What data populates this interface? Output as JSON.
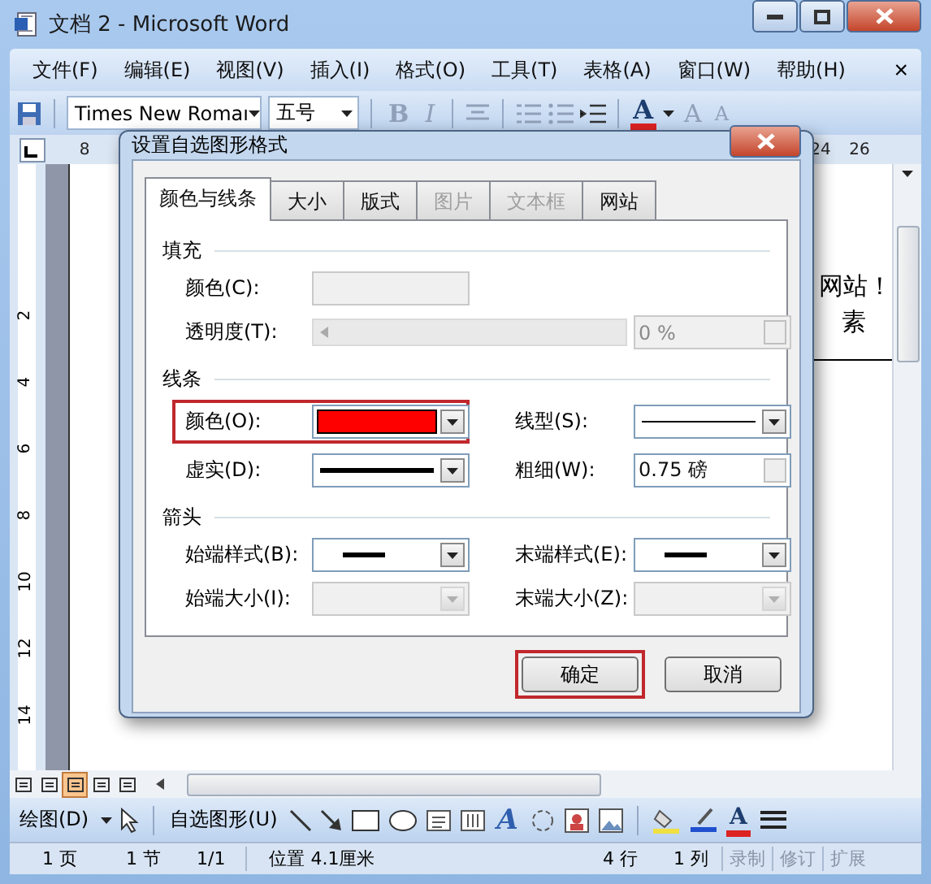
{
  "window": {
    "title": "文档 2 - Microsoft Word"
  },
  "menu": {
    "items": [
      "文件(F)",
      "编辑(E)",
      "视图(V)",
      "插入(I)",
      "格式(O)",
      "工具(T)",
      "表格(A)",
      "窗口(W)",
      "帮助(H)"
    ],
    "close": "×"
  },
  "toolbar": {
    "font": "Times New Romaı",
    "size": "五号",
    "format_buttons": [
      {
        "label": "B",
        "disabled": true
      },
      {
        "label": "I",
        "disabled": true
      }
    ],
    "font_color": "A",
    "grow": "A",
    "shrink": "A"
  },
  "ruler": {
    "labels": [
      "8",
      "24",
      "26"
    ],
    "vertical_labels": [
      "2",
      "4",
      "6",
      "8",
      "10",
      "12",
      "14"
    ]
  },
  "document": {
    "lines": [
      "网站！",
      "素"
    ]
  },
  "dialog": {
    "title": "设置自选图形格式",
    "tabs": [
      {
        "label": "颜色与线条",
        "selected": true,
        "disabled": false
      },
      {
        "label": "大小",
        "selected": false,
        "disabled": false
      },
      {
        "label": "版式",
        "selected": false,
        "disabled": false
      },
      {
        "label": "图片",
        "selected": false,
        "disabled": true
      },
      {
        "label": "文本框",
        "selected": false,
        "disabled": true
      },
      {
        "label": "网站",
        "selected": false,
        "disabled": false
      }
    ],
    "sections": [
      {
        "title": "填充",
        "rows": [
          [
            {
              "label": "颜色(C):",
              "kind": "color",
              "disabled": true,
              "highlighted": false
            }
          ],
          [
            {
              "label": "透明度(T):",
              "kind": "slider",
              "disabled": true,
              "highlighted": false
            },
            {
              "kind": "spinner",
              "value": "0 %",
              "disabled": true
            }
          ]
        ]
      },
      {
        "title": "线条",
        "rows": [
          [
            {
              "label": "颜色(O):",
              "kind": "color",
              "color": "#ff0000",
              "disabled": false,
              "highlighted": true
            },
            {
              "label": "线型(S):",
              "kind": "thin_line",
              "disabled": false,
              "highlighted": false
            }
          ],
          [
            {
              "label": "虚实(D):",
              "kind": "thick_line",
              "disabled": false,
              "highlighted": false
            },
            {
              "label": "粗细(W):",
              "kind": "spinner",
              "value": "0.75 磅",
              "disabled": false,
              "highlighted": false
            }
          ]
        ]
      },
      {
        "title": "箭头",
        "rows": [
          [
            {
              "label": "始端样式(B):",
              "kind": "arrow",
              "disabled": false,
              "highlighted": false
            },
            {
              "label": "末端样式(E):",
              "kind": "arrow",
              "disabled": false,
              "highlighted": false
            }
          ],
          [
            {
              "label": "始端大小(I):",
              "kind": "arrow",
              "disabled": true,
              "highlighted": false
            },
            {
              "label": "末端大小(Z):",
              "kind": "arrow",
              "disabled": true,
              "highlighted": false
            }
          ]
        ]
      }
    ],
    "buttons": [
      {
        "label": "确定",
        "highlighted": true
      },
      {
        "label": "取消",
        "highlighted": false
      }
    ]
  },
  "drawing": {
    "draw_menu": "绘图(D)",
    "autoshapes": "自选图形(U)",
    "wordart": "A",
    "font_color": "A"
  },
  "status_bar": {
    "cells": [
      "1 页",
      "1 节",
      "1/1",
      "位置 4.1厘米",
      "4 行",
      "1 列"
    ],
    "modes": [
      "录制",
      "修订",
      "扩展"
    ]
  }
}
